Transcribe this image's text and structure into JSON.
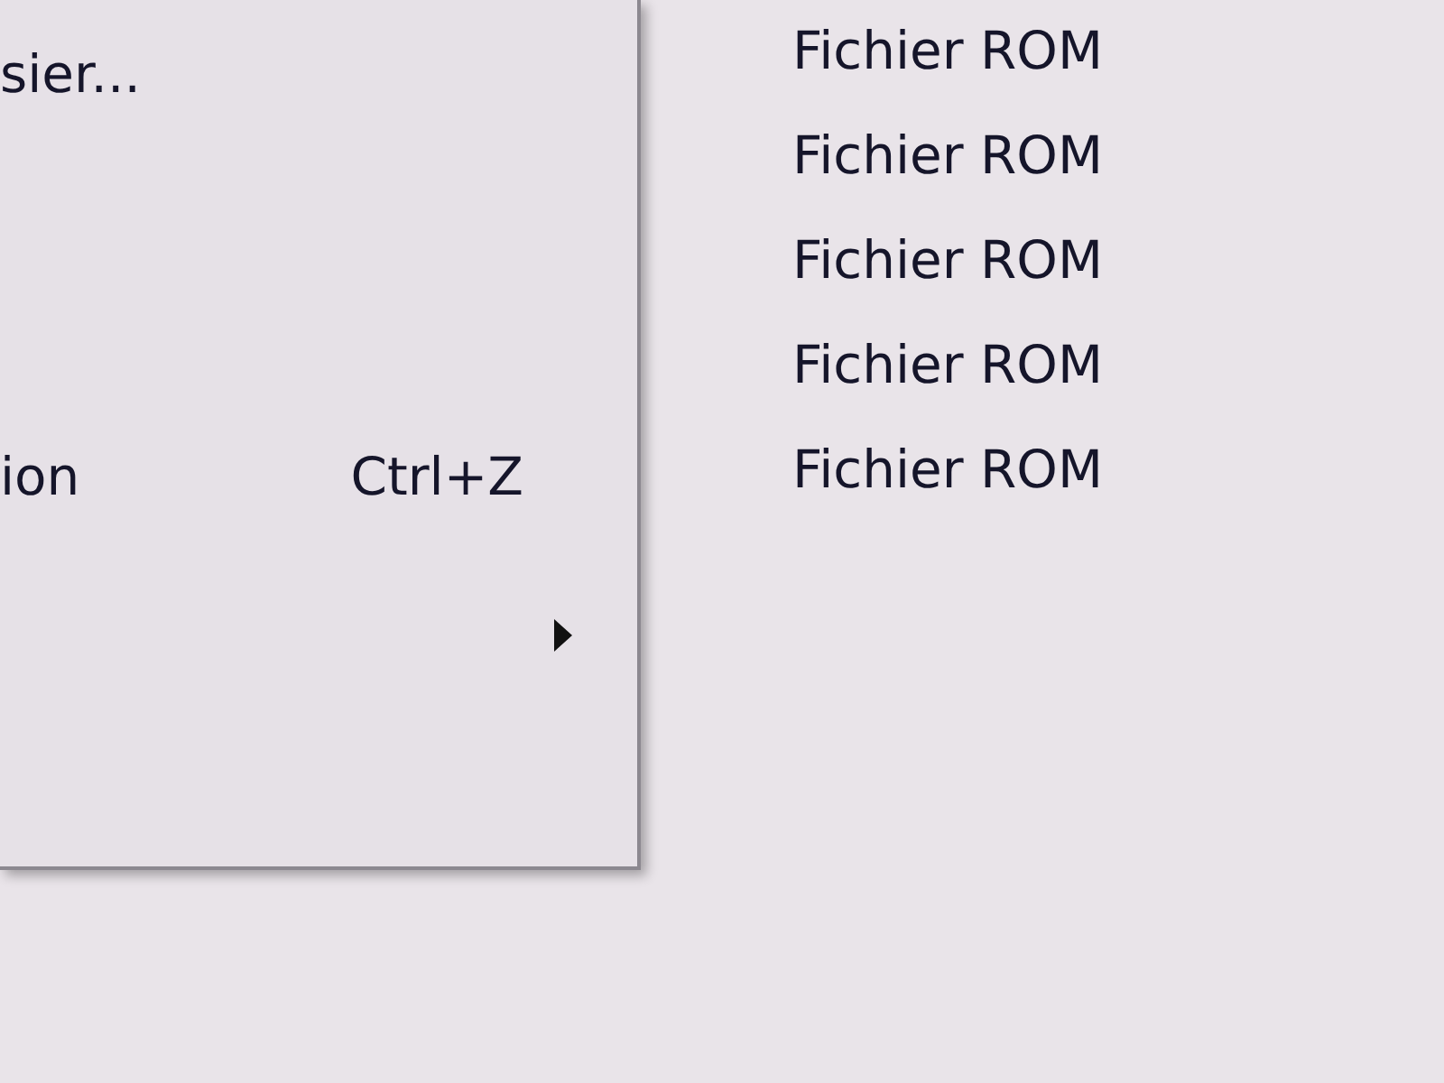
{
  "menu": {
    "items": [
      {
        "kind": "command",
        "label": "sier..."
      },
      {
        "kind": "command",
        "label": "ion",
        "shortcut": "Ctrl+Z"
      },
      {
        "kind": "submenu"
      }
    ]
  },
  "list": {
    "rows": [
      {
        "column_2": "Fichier ROM"
      },
      {
        "column_2": "Fichier ROM"
      },
      {
        "column_2": "Fichier ROM"
      },
      {
        "column_2": "Fichier ROM"
      },
      {
        "column_2": "Fichier ROM"
      }
    ]
  }
}
